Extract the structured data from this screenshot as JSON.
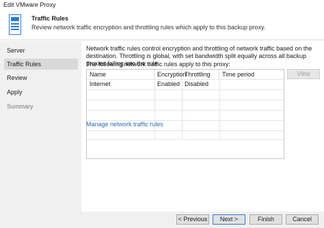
{
  "window": {
    "title": "Edit VMware Proxy"
  },
  "header": {
    "title": "Traffic Rules",
    "subtitle": "Review network traffic encryption and throttling rules which apply to this backup proxy."
  },
  "sidebar": {
    "items": [
      {
        "label": "Server",
        "state": "normal"
      },
      {
        "label": "Traffic Rules",
        "state": "active"
      },
      {
        "label": "Review",
        "state": "normal"
      },
      {
        "label": "Apply",
        "state": "normal"
      },
      {
        "label": "Summary",
        "state": "disabled"
      }
    ]
  },
  "content": {
    "description": "Network traffic rules control encryption and throttling of network traffic based on the destination. Throttling is global, with set bandwidth split equally across all backup proxies falling into the rule.",
    "list_label": "The following network traffic rules apply to this proxy:",
    "columns": [
      "Name",
      "Encryption",
      "Throttling",
      "Time period"
    ],
    "rows": [
      [
        "Internet",
        "Enabled",
        "Disabled",
        ""
      ]
    ],
    "view_button": "View",
    "manage_link": "Manage network traffic rules"
  },
  "footer": {
    "previous": "< Previous",
    "next": "Next >",
    "finish": "Finish",
    "cancel": "Cancel"
  },
  "colors": {
    "accent": "#2b79d6",
    "link": "#2e6eb5",
    "sidebar_bg": "#f0f0f0",
    "active_item": "#d9d9d9"
  }
}
